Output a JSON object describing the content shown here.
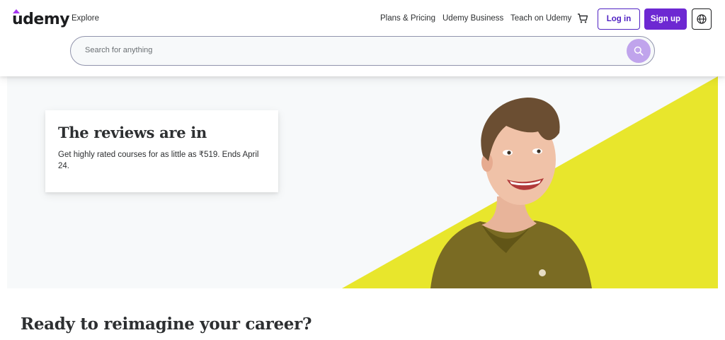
{
  "header": {
    "logo_text": "udemy",
    "explore_label": "Explore",
    "nav_links": [
      "Plans & Pricing",
      "Udemy Business",
      "Teach on Udemy"
    ],
    "login_label": "Log in",
    "signup_label": "Sign up",
    "cart_icon": "cart-icon",
    "globe_icon": "globe-icon"
  },
  "search": {
    "placeholder": "Search for anything",
    "icon": "search-icon"
  },
  "hero": {
    "title": "The reviews are in",
    "body": "Get highly rated courses for as little as ₹519. Ends April 24."
  },
  "section": {
    "title": "Ready to reimagine your career?"
  },
  "colors": {
    "brand_purple": "#6d28d2",
    "accent_yellow": "#e8e62c",
    "hero_bg": "#f7f9fa"
  }
}
